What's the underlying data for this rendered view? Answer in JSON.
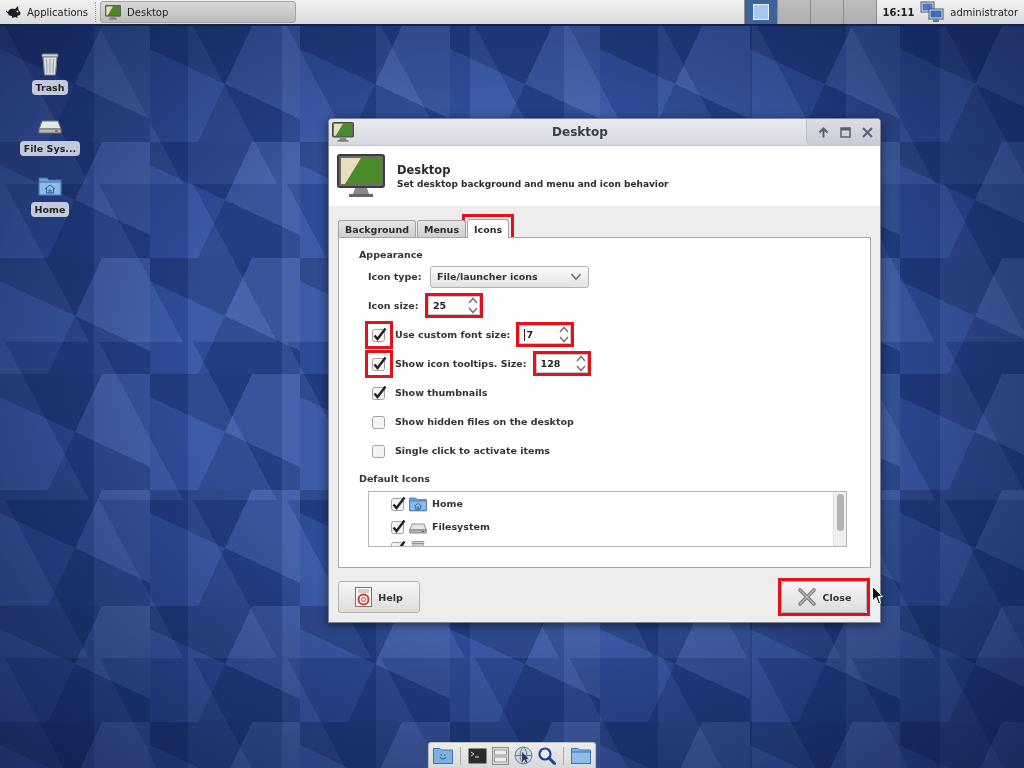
{
  "top_panel": {
    "menu_button": "Applications",
    "tasks": [
      {
        "label": "Desktop"
      }
    ],
    "workspaces": [
      {
        "selected": true,
        "has_window": true
      },
      {
        "selected": false,
        "has_window": false
      },
      {
        "selected": false,
        "has_window": false
      },
      {
        "selected": false,
        "has_window": false
      }
    ],
    "clock": "16:11",
    "user": "administrator"
  },
  "desktop_icons": [
    {
      "kind": "trash",
      "label": "Trash"
    },
    {
      "kind": "drive",
      "label": "File Sys..."
    },
    {
      "kind": "home",
      "label": "Home"
    }
  ],
  "dialog": {
    "title": "Desktop",
    "header": {
      "title": "Desktop",
      "subtitle": "Set desktop background and menu and icon behavior"
    },
    "tabs": [
      {
        "label": "Background",
        "selected": false,
        "highlighted": false
      },
      {
        "label": "Menus",
        "selected": false,
        "highlighted": false
      },
      {
        "label": "Icons",
        "selected": true,
        "highlighted": true
      }
    ],
    "appearance": {
      "heading": "Appearance",
      "icon_type": {
        "label": "Icon type:",
        "value": "File/launcher icons"
      },
      "icon_size": {
        "label": "Icon size:",
        "value": "25",
        "highlighted": true
      },
      "options": [
        {
          "kind": "spin",
          "label": "Use custom font size:",
          "checked": true,
          "checkbox_highlighted": true,
          "value": "7",
          "focused": true,
          "spin_highlighted": true
        },
        {
          "kind": "spin",
          "label": "Show icon tooltips. Size:",
          "checked": true,
          "checkbox_highlighted": true,
          "value": "128",
          "focused": false,
          "spin_highlighted": true
        },
        {
          "kind": "check",
          "label": "Show thumbnails",
          "checked": true,
          "checkbox_highlighted": false
        },
        {
          "kind": "check",
          "label": "Show hidden files on the desktop",
          "checked": false,
          "checkbox_highlighted": false
        },
        {
          "kind": "check",
          "label": "Single click to activate items",
          "checked": false,
          "checkbox_highlighted": false
        }
      ]
    },
    "default_icons": {
      "heading": "Default Icons",
      "items": [
        {
          "kind": "home",
          "label": "Home",
          "checked": true
        },
        {
          "kind": "drive",
          "label": "Filesystem",
          "checked": true
        },
        {
          "kind": "trash",
          "checked": true
        }
      ]
    },
    "buttons": [
      {
        "kind": "help",
        "label": "Help",
        "highlighted": false
      },
      {
        "kind": "close",
        "label": "Close",
        "highlighted": true
      }
    ]
  }
}
